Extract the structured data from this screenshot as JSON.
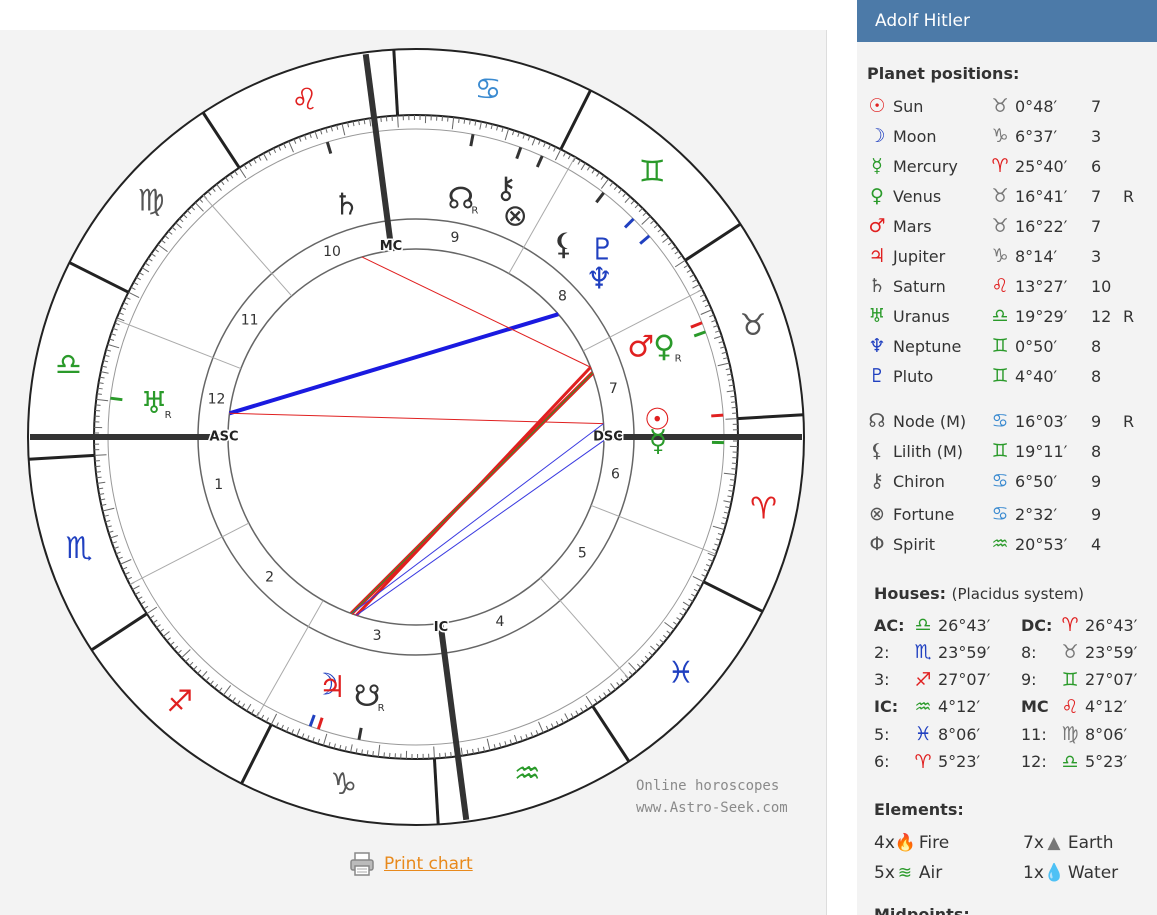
{
  "person": {
    "name": "Adolf Hitler"
  },
  "watermark": {
    "line1": "Online horoscopes",
    "line2": "www.Astro-Seek.com"
  },
  "print_link": "Print chart",
  "planets_title": "Planet positions:",
  "planets": [
    {
      "glyph": "☉",
      "name": "Sun",
      "sign": "♉",
      "deg": "0°48′",
      "house": "7",
      "retro": "",
      "color": "#e02020",
      "sign_color": "#777777"
    },
    {
      "glyph": "☽",
      "name": "Moon",
      "sign": "♑",
      "deg": "6°37′",
      "house": "3",
      "retro": "",
      "color": "#2040c0",
      "sign_color": "#777777"
    },
    {
      "glyph": "☿",
      "name": "Mercury",
      "sign": "♈",
      "deg": "25°40′",
      "house": "6",
      "retro": "",
      "color": "#2a9a2a",
      "sign_color": "#e02020"
    },
    {
      "glyph": "♀",
      "name": "Venus",
      "sign": "♉",
      "deg": "16°41′",
      "house": "7",
      "retro": "R",
      "color": "#2a9a2a",
      "sign_color": "#777777"
    },
    {
      "glyph": "♂",
      "name": "Mars",
      "sign": "♉",
      "deg": "16°22′",
      "house": "7",
      "retro": "",
      "color": "#e02020",
      "sign_color": "#777777"
    },
    {
      "glyph": "♃",
      "name": "Jupiter",
      "sign": "♑",
      "deg": "8°14′",
      "house": "3",
      "retro": "",
      "color": "#e02020",
      "sign_color": "#777777"
    },
    {
      "glyph": "♄",
      "name": "Saturn",
      "sign": "♌",
      "deg": "13°27′",
      "house": "10",
      "retro": "",
      "color": "#555555",
      "sign_color": "#e02020"
    },
    {
      "glyph": "♅",
      "name": "Uranus",
      "sign": "♎",
      "deg": "19°29′",
      "house": "12",
      "retro": "R",
      "color": "#2a9a2a",
      "sign_color": "#2a9a2a"
    },
    {
      "glyph": "♆",
      "name": "Neptune",
      "sign": "♊",
      "deg": "0°50′",
      "house": "8",
      "retro": "",
      "color": "#2040c0",
      "sign_color": "#2a9a2a"
    },
    {
      "glyph": "♇",
      "name": "Pluto",
      "sign": "♊",
      "deg": "4°40′",
      "house": "8",
      "retro": "",
      "color": "#2040c0",
      "sign_color": "#2a9a2a"
    },
    {
      "glyph": "☊",
      "name": "Node (M)",
      "sign": "♋",
      "deg": "16°03′",
      "house": "9",
      "retro": "R",
      "color": "#555555",
      "sign_color": "#3a8ad0"
    },
    {
      "glyph": "⚸",
      "name": "Lilith (M)",
      "sign": "♊",
      "deg": "19°11′",
      "house": "8",
      "retro": "",
      "color": "#555555",
      "sign_color": "#2a9a2a"
    },
    {
      "glyph": "⚷",
      "name": "Chiron",
      "sign": "♋",
      "deg": "6°50′",
      "house": "9",
      "retro": "",
      "color": "#555555",
      "sign_color": "#3a8ad0"
    },
    {
      "glyph": "⊗",
      "name": "Fortune",
      "sign": "♋",
      "deg": "2°32′",
      "house": "9",
      "retro": "",
      "color": "#555555",
      "sign_color": "#3a8ad0"
    },
    {
      "glyph": "Φ",
      "name": "Spirit",
      "sign": "♒",
      "deg": "20°53′",
      "house": "4",
      "retro": "",
      "color": "#555555",
      "sign_color": "#2a9a2a"
    }
  ],
  "houses_title": "Houses:",
  "houses_system": "(Placidus system)",
  "houses": [
    {
      "label": "AC:",
      "sign": "♎",
      "deg": "26°43′",
      "bold": true,
      "sign_color": "#2a9a2a"
    },
    {
      "label": "DC:",
      "sign": "♈",
      "deg": "26°43′",
      "bold": true,
      "sign_color": "#e02020"
    },
    {
      "label": "2:",
      "sign": "♏",
      "deg": "23°59′",
      "bold": false,
      "sign_color": "#2040c0"
    },
    {
      "label": "8:",
      "sign": "♉",
      "deg": "23°59′",
      "bold": false,
      "sign_color": "#777777"
    },
    {
      "label": "3:",
      "sign": "♐",
      "deg": "27°07′",
      "bold": false,
      "sign_color": "#e02020"
    },
    {
      "label": "9:",
      "sign": "♊",
      "deg": "27°07′",
      "bold": false,
      "sign_color": "#2a9a2a"
    },
    {
      "label": "IC:",
      "sign": "♒",
      "deg": "4°12′",
      "bold": true,
      "sign_color": "#2a9a2a"
    },
    {
      "label": "MC",
      "sign": "♌",
      "deg": "4°12′",
      "bold": true,
      "sign_color": "#e02020"
    },
    {
      "label": "5:",
      "sign": "♓",
      "deg": "8°06′",
      "bold": false,
      "sign_color": "#2040c0"
    },
    {
      "label": "11:",
      "sign": "♍",
      "deg": "8°06′",
      "bold": false,
      "sign_color": "#777777"
    },
    {
      "label": "6:",
      "sign": "♈",
      "deg": "5°23′",
      "bold": false,
      "sign_color": "#e02020"
    },
    {
      "label": "12:",
      "sign": "♎",
      "deg": "5°23′",
      "bold": false,
      "sign_color": "#2a9a2a"
    }
  ],
  "elements_title": "Elements:",
  "elements": [
    {
      "count": "4x",
      "name": "Fire",
      "icon": "🔥",
      "color": "#e8602a"
    },
    {
      "count": "7x",
      "name": "Earth",
      "icon": "▲",
      "color": "#777777"
    },
    {
      "count": "5x",
      "name": "Air",
      "icon": "≋",
      "color": "#2a9a2a"
    },
    {
      "count": "1x",
      "name": "Water",
      "icon": "💧",
      "color": "#2a7ad0"
    }
  ],
  "midpoints_title": "Midpoints:",
  "chart_wheel": {
    "ascendant": 206.72,
    "zodiac_signs": [
      {
        "glyph": "♈",
        "color": "#e02020"
      },
      {
        "glyph": "♉",
        "color": "#555555"
      },
      {
        "glyph": "♊",
        "color": "#2a9a2a"
      },
      {
        "glyph": "♋",
        "color": "#3a8ad0"
      },
      {
        "glyph": "♌",
        "color": "#e02020"
      },
      {
        "glyph": "♍",
        "color": "#555555"
      },
      {
        "glyph": "♎",
        "color": "#2a9a2a"
      },
      {
        "glyph": "♏",
        "color": "#2040c0"
      },
      {
        "glyph": "♐",
        "color": "#e02020"
      },
      {
        "glyph": "♑",
        "color": "#555555"
      },
      {
        "glyph": "♒",
        "color": "#2a9a2a"
      },
      {
        "glyph": "♓",
        "color": "#2040c0"
      }
    ],
    "house_cusps": [
      206.72,
      233.98,
      267.12,
      304.2,
      338.1,
      5.38,
      26.72,
      53.98,
      87.12,
      124.2,
      158.1,
      185.38
    ],
    "house_numbers": [
      "1",
      "2",
      "3",
      "4",
      "5",
      "6",
      "7",
      "8",
      "9",
      "10",
      "11",
      "12"
    ],
    "angle_labels": {
      "asc": "ASC",
      "dsc": "DSC",
      "mc": "MC",
      "ic": "IC"
    },
    "planet_glyphs": [
      {
        "glyph": "☉",
        "lon": 30.8,
        "color": "#e02020",
        "retro": ""
      },
      {
        "glyph": "☽",
        "lon": 276.62,
        "color": "#2040c0",
        "retro": ""
      },
      {
        "glyph": "☿",
        "lon": 25.67,
        "color": "#2a9a2a",
        "retro": ""
      },
      {
        "glyph": "♀",
        "lon": 46.68,
        "color": "#2a9a2a",
        "retro": "R"
      },
      {
        "glyph": "♂",
        "lon": 48.5,
        "color": "#e02020",
        "retro": ""
      },
      {
        "glyph": "♃",
        "lon": 278.23,
        "color": "#e02020",
        "retro": ""
      },
      {
        "glyph": "♄",
        "lon": 133.45,
        "color": "#333333",
        "retro": ""
      },
      {
        "glyph": "♅",
        "lon": 199.48,
        "color": "#2a9a2a",
        "retro": "R"
      },
      {
        "glyph": "♆",
        "lon": 67.5,
        "color": "#2040c0",
        "retro": ""
      },
      {
        "glyph": "♇",
        "lon": 71.8,
        "color": "#2040c0",
        "retro": ""
      },
      {
        "glyph": "☊",
        "lon": 106.05,
        "color": "#333333",
        "retro": "R"
      },
      {
        "glyph": "☋",
        "lon": 286.05,
        "color": "#333333",
        "retro": "R"
      },
      {
        "glyph": "⚸",
        "lon": 79.18,
        "color": "#333333",
        "retro": ""
      },
      {
        "glyph": "⚷",
        "lon": 96.83,
        "color": "#333333",
        "retro": ""
      },
      {
        "glyph": "⊗",
        "lon": 92.53,
        "color": "#333333",
        "retro": ""
      }
    ],
    "aspect_lines": [
      {
        "from": 276.62,
        "to": 46.68,
        "color": "#e02020",
        "width": 4
      },
      {
        "from": 278.23,
        "to": 48.5,
        "color": "#e02020",
        "width": 3
      },
      {
        "from": 199.48,
        "to": 67.5,
        "color": "#1a1ae0",
        "width": 4
      },
      {
        "from": 199.48,
        "to": 30.8,
        "color": "#e02020",
        "width": 1
      },
      {
        "from": 276.62,
        "to": 30.8,
        "color": "#3a3ae0",
        "width": 1
      },
      {
        "from": 278.23,
        "to": 25.67,
        "color": "#3a3ae0",
        "width": 1
      },
      {
        "from": 276.62,
        "to": 46.68,
        "color": "#2a9a2a",
        "width": 1
      },
      {
        "from": 133.45,
        "to": 48.5,
        "color": "#e02020",
        "width": 1
      }
    ]
  }
}
